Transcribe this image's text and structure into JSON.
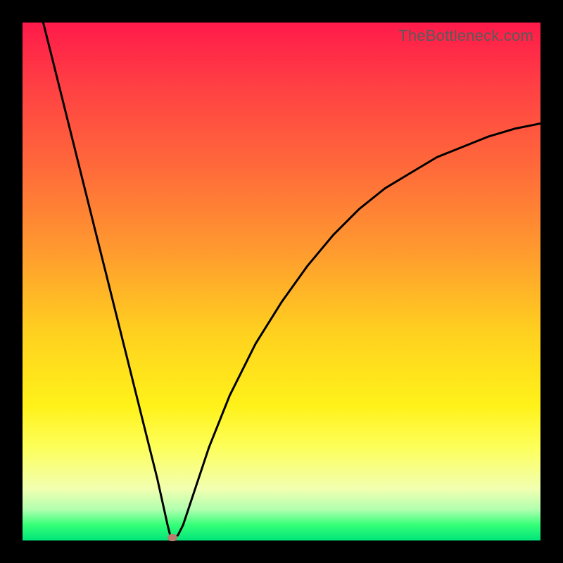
{
  "attribution": "TheBottleneck.com",
  "colors": {
    "frame": "#000000",
    "gradient_top": "#ff1a4a",
    "gradient_bottom": "#00e57a",
    "curve": "#000000",
    "marker": "#b77d6e"
  },
  "chart_data": {
    "type": "line",
    "title": "",
    "xlabel": "",
    "ylabel": "",
    "xlim": [
      0,
      100
    ],
    "ylim": [
      0,
      100
    ],
    "series": [
      {
        "name": "bottleneck-curve",
        "x": [
          4,
          6,
          8,
          10,
          12,
          14,
          16,
          18,
          20,
          22,
          24,
          26,
          28,
          28.5,
          29,
          30,
          31,
          33,
          36,
          40,
          45,
          50,
          55,
          60,
          65,
          70,
          75,
          80,
          85,
          90,
          95,
          100
        ],
        "y": [
          100,
          92,
          84,
          76,
          68,
          60,
          52,
          44,
          36,
          28,
          20,
          12,
          3,
          1,
          0.5,
          1,
          3,
          9,
          18,
          28,
          38,
          46,
          53,
          59,
          64,
          68,
          71,
          74,
          76,
          78,
          79.5,
          80.5
        ]
      }
    ],
    "marker": {
      "x": 29,
      "y": 0.5
    },
    "grid": false,
    "legend": false
  }
}
